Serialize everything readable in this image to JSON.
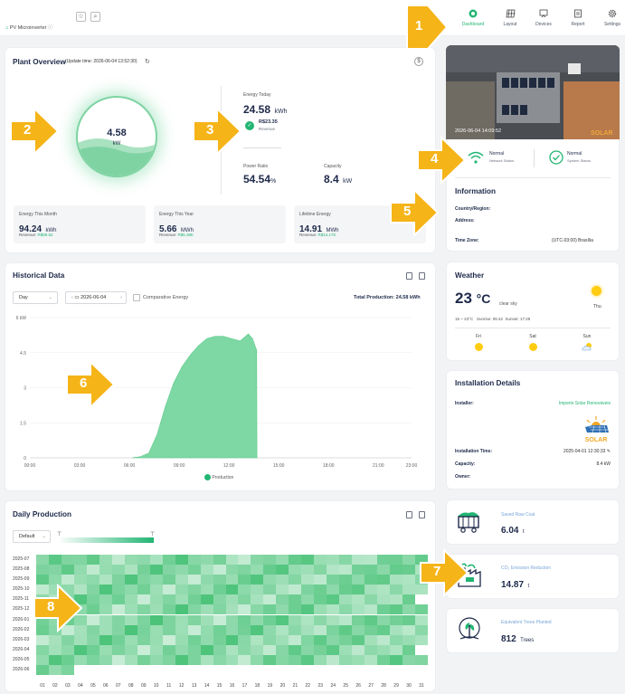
{
  "brand": {
    "name": "PV Microinverter"
  },
  "nav": [
    {
      "label": "Dashboard",
      "icon": "dashboard-icon",
      "active": true
    },
    {
      "label": "Layout",
      "icon": "grid-icon"
    },
    {
      "label": "Devices",
      "icon": "devices-icon"
    },
    {
      "label": "Report",
      "icon": "report-icon"
    },
    {
      "label": "Settings",
      "icon": "gear-icon"
    }
  ],
  "plant": {
    "title": "Plant Overview",
    "update": "(Update time: 2026-06-04 13:52:30)",
    "gauge_value": "4.58",
    "gauge_unit": "kW",
    "energy_today_label": "Energy Today",
    "energy_today": "24.58",
    "energy_today_unit": "kWh",
    "revenue_value": "R$23.35",
    "revenue_label": "Revenue",
    "power_ratio_label": "Power Ratio",
    "power_ratio": "54.54",
    "power_ratio_unit": "%",
    "capacity_label": "Capacity",
    "capacity": "8.4",
    "capacity_unit": "kW",
    "month": {
      "label": "Energy This Month",
      "value": "94.24",
      "unit": "kWh",
      "rev_label": "Revenue:",
      "rev": "R$89.52"
    },
    "year": {
      "label": "Energy This Year",
      "value": "5.66",
      "unit": "MWh",
      "rev_label": "Revenue:",
      "rev": "R$5.38K"
    },
    "lifetime": {
      "label": "Lifetime Energy",
      "value": "14.91",
      "unit": "MWh",
      "rev_label": "Revenue:",
      "rev": "R$14.17K"
    }
  },
  "photo": {
    "timestamp": "2026-06-04 14:09:52",
    "watermark": "SOLAR"
  },
  "status": {
    "network_value": "Normal",
    "network_label": "Network Status",
    "system_value": "Normal",
    "system_label": "System Status"
  },
  "info": {
    "title": "Information",
    "country_label": "Country/Region:",
    "address_label": "Address:",
    "tz_label": "Time Zone:",
    "tz_value": "(UTC-03:00) Brasília"
  },
  "history": {
    "title": "Historical Data",
    "range": "Day",
    "date": "2026-06-04",
    "compare_label": "Comparative Energy",
    "total_label": "Total Production:",
    "total_value": "24.58 kWh",
    "legend": "Production"
  },
  "chart_data": {
    "type": "area",
    "ylabel": "kW",
    "ylim": [
      0,
      6
    ],
    "yticks": [
      "6 kW",
      "4.5",
      "3",
      "1.5",
      "0"
    ],
    "xticks": [
      "00:00",
      "03:00",
      "06:00",
      "09:00",
      "12:00",
      "15:00",
      "18:00",
      "21:00",
      "23:00"
    ],
    "series": [
      {
        "name": "Production",
        "color": "#7dd8a3",
        "x": [
          "06:10",
          "06:40",
          "07:10",
          "07:40",
          "08:10",
          "08:40",
          "09:10",
          "09:40",
          "10:10",
          "10:40",
          "11:10",
          "11:40",
          "12:10",
          "12:40",
          "13:10",
          "13:25",
          "13:40",
          "13:41"
        ],
        "values": [
          0,
          0.05,
          0.2,
          1.0,
          2.2,
          3.2,
          3.9,
          4.4,
          4.8,
          5.1,
          5.2,
          5.2,
          5.1,
          5.0,
          5.3,
          5.1,
          4.6,
          0
        ]
      }
    ]
  },
  "weather": {
    "title": "Weather",
    "temp": "23",
    "unit": "°C",
    "cond": "clear sky",
    "today_day": "Thu",
    "range": "15 ~ 23°C",
    "sunrise": "Sunrise: 06:42",
    "sunset": "Sunset: 17:29",
    "days": [
      "Fri",
      "Sat",
      "Sun"
    ]
  },
  "install": {
    "title": "Installation Details",
    "installer_label": "Installer:",
    "installer": "Imperio Solar Renováveis",
    "time_label": "Installation Time:",
    "time": "2025-04-01 12:30:33",
    "capacity_label": "Capacity:",
    "capacity": "8.4 kW",
    "owner_label": "Owner:",
    "logo_text": "SOLAR"
  },
  "daily": {
    "title": "Daily Production",
    "mode": "Default",
    "months": [
      "2025-07",
      "2025-08",
      "2025-09",
      "2025-10",
      "2025-11",
      "2025-12",
      "2026-01",
      "2026-02",
      "2026-03",
      "2026-04",
      "2026-05",
      "2026-06"
    ],
    "days": [
      "01",
      "02",
      "03",
      "04",
      "05",
      "06",
      "07",
      "08",
      "09",
      "10",
      "11",
      "12",
      "13",
      "14",
      "15",
      "16",
      "17",
      "18",
      "19",
      "20",
      "21",
      "22",
      "23",
      "24",
      "25",
      "26",
      "27",
      "28",
      "29",
      "30",
      "31"
    ]
  },
  "metrics": [
    {
      "label": "Saved Raw Coal",
      "value": "6.04",
      "unit": "t",
      "icon": "coal-icon"
    },
    {
      "label": "CO₂ Emission Reduction",
      "value": "14.87",
      "unit": "t",
      "icon": "factory-icon"
    },
    {
      "label": "Equivalent Trees Planted",
      "value": "812",
      "unit": "Trees",
      "icon": "tree-icon"
    }
  ],
  "callouts": [
    "1",
    "2",
    "3",
    "4",
    "5",
    "6",
    "7",
    "8"
  ],
  "colors": {
    "accent": "#22b573",
    "callout": "#f5b418",
    "navy": "#1e2a4a"
  }
}
